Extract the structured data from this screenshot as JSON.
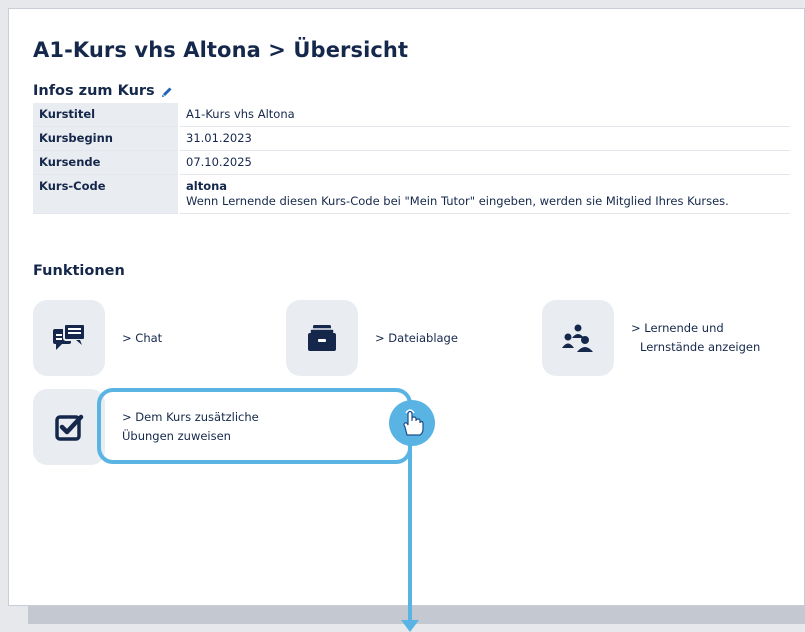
{
  "page": {
    "title": "A1-Kurs vhs Altona > Übersicht"
  },
  "info": {
    "heading": "Infos zum Kurs",
    "rows": [
      {
        "label": "Kurstitel",
        "value": "A1-Kurs vhs Altona"
      },
      {
        "label": "Kursbeginn",
        "value": "31.01.2023"
      },
      {
        "label": "Kursende",
        "value": "07.10.2025"
      },
      {
        "label": "Kurs-Code",
        "value": "altona",
        "hint": "Wenn Lernende diesen Kurs-Code bei \"Mein Tutor\" eingeben, werden sie Mitglied Ihres Kurses."
      }
    ]
  },
  "functions": {
    "heading": "Funktionen",
    "items": [
      {
        "icon": "chat-icon",
        "line1": "> Chat",
        "line2": ""
      },
      {
        "icon": "file-storage-icon",
        "line1": "> Dateiablage",
        "line2": ""
      },
      {
        "icon": "learners-icon",
        "line1": "> Lernende und",
        "line2": "Lernstände anzeigen"
      },
      {
        "icon": "assign-exercises-icon",
        "line1": "> Dem Kurs zusätzliche",
        "line2": "Übungen zuweisen"
      }
    ]
  },
  "colors": {
    "text": "#15284b",
    "icon": "#15284b",
    "tile_bg": "#e9ecf1",
    "highlight": "#5ab4e3"
  }
}
